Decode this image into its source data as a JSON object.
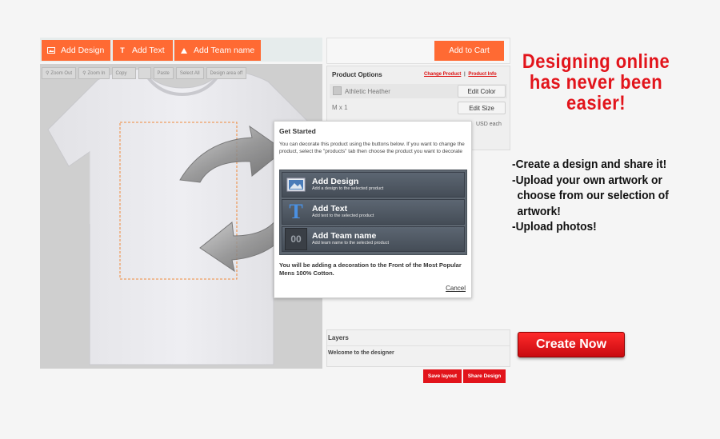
{
  "toolbar": {
    "add_design": "Add Design",
    "add_text": "Add Text",
    "add_team_name": "Add Team name"
  },
  "zoom_bar": {
    "zoom_out": "Zoom Out",
    "zoom_in": "Zoom In",
    "copy": "Copy",
    "paste": "Paste",
    "select_all": "Select All",
    "design_area": "Design area off"
  },
  "cart": {
    "add_to_cart": "Add to Cart"
  },
  "product_options": {
    "title": "Product Options",
    "change_product": "Change Product",
    "separator": "|",
    "product_info": "Product Info",
    "color_name": "Athletic Heather",
    "edit_color": "Edit Color",
    "size_qty": "M x 1",
    "edit_size": "Edit Size",
    "price_unit": "USD each"
  },
  "dialog": {
    "title": "Get Started",
    "description": "You can decorate this product using the buttons below. If you want to change the product, select the \"products\" tab then choose the product you want to decorate",
    "items": [
      {
        "title": "Add Design",
        "subtitle": "Add a design to the selected product",
        "icon": "image-icon"
      },
      {
        "title": "Add Text",
        "subtitle": "Add text to the selected product",
        "icon": "text-t-icon"
      },
      {
        "title": "Add Team name",
        "subtitle": "Add team name to the selected product",
        "icon": "team-number-icon"
      }
    ],
    "team_icon_text": "00",
    "text_icon_text": "T",
    "note": "You will be adding a decoration to the Front of the Most Popular Mens 100% Cotton.",
    "cancel": "Cancel"
  },
  "layers": {
    "title": "Layers",
    "welcome": "Welcome to the designer",
    "save_layout": "Save layout",
    "share_design": "Share Design"
  },
  "promo": {
    "headline_1": "Designing online",
    "headline_2": "has never been",
    "headline_3": "easier!",
    "bullet_1": "-Create a design and share it!",
    "bullet_2": "-Upload your own artwork or",
    "bullet_3": "choose from our selection of",
    "bullet_4": "artwork!",
    "bullet_5": "-Upload photos!",
    "cta": "Create Now"
  },
  "colors": {
    "accent_orange": "#ff6a33",
    "brand_red": "#e2141b",
    "canvas_bg": "#cfcfcf"
  }
}
